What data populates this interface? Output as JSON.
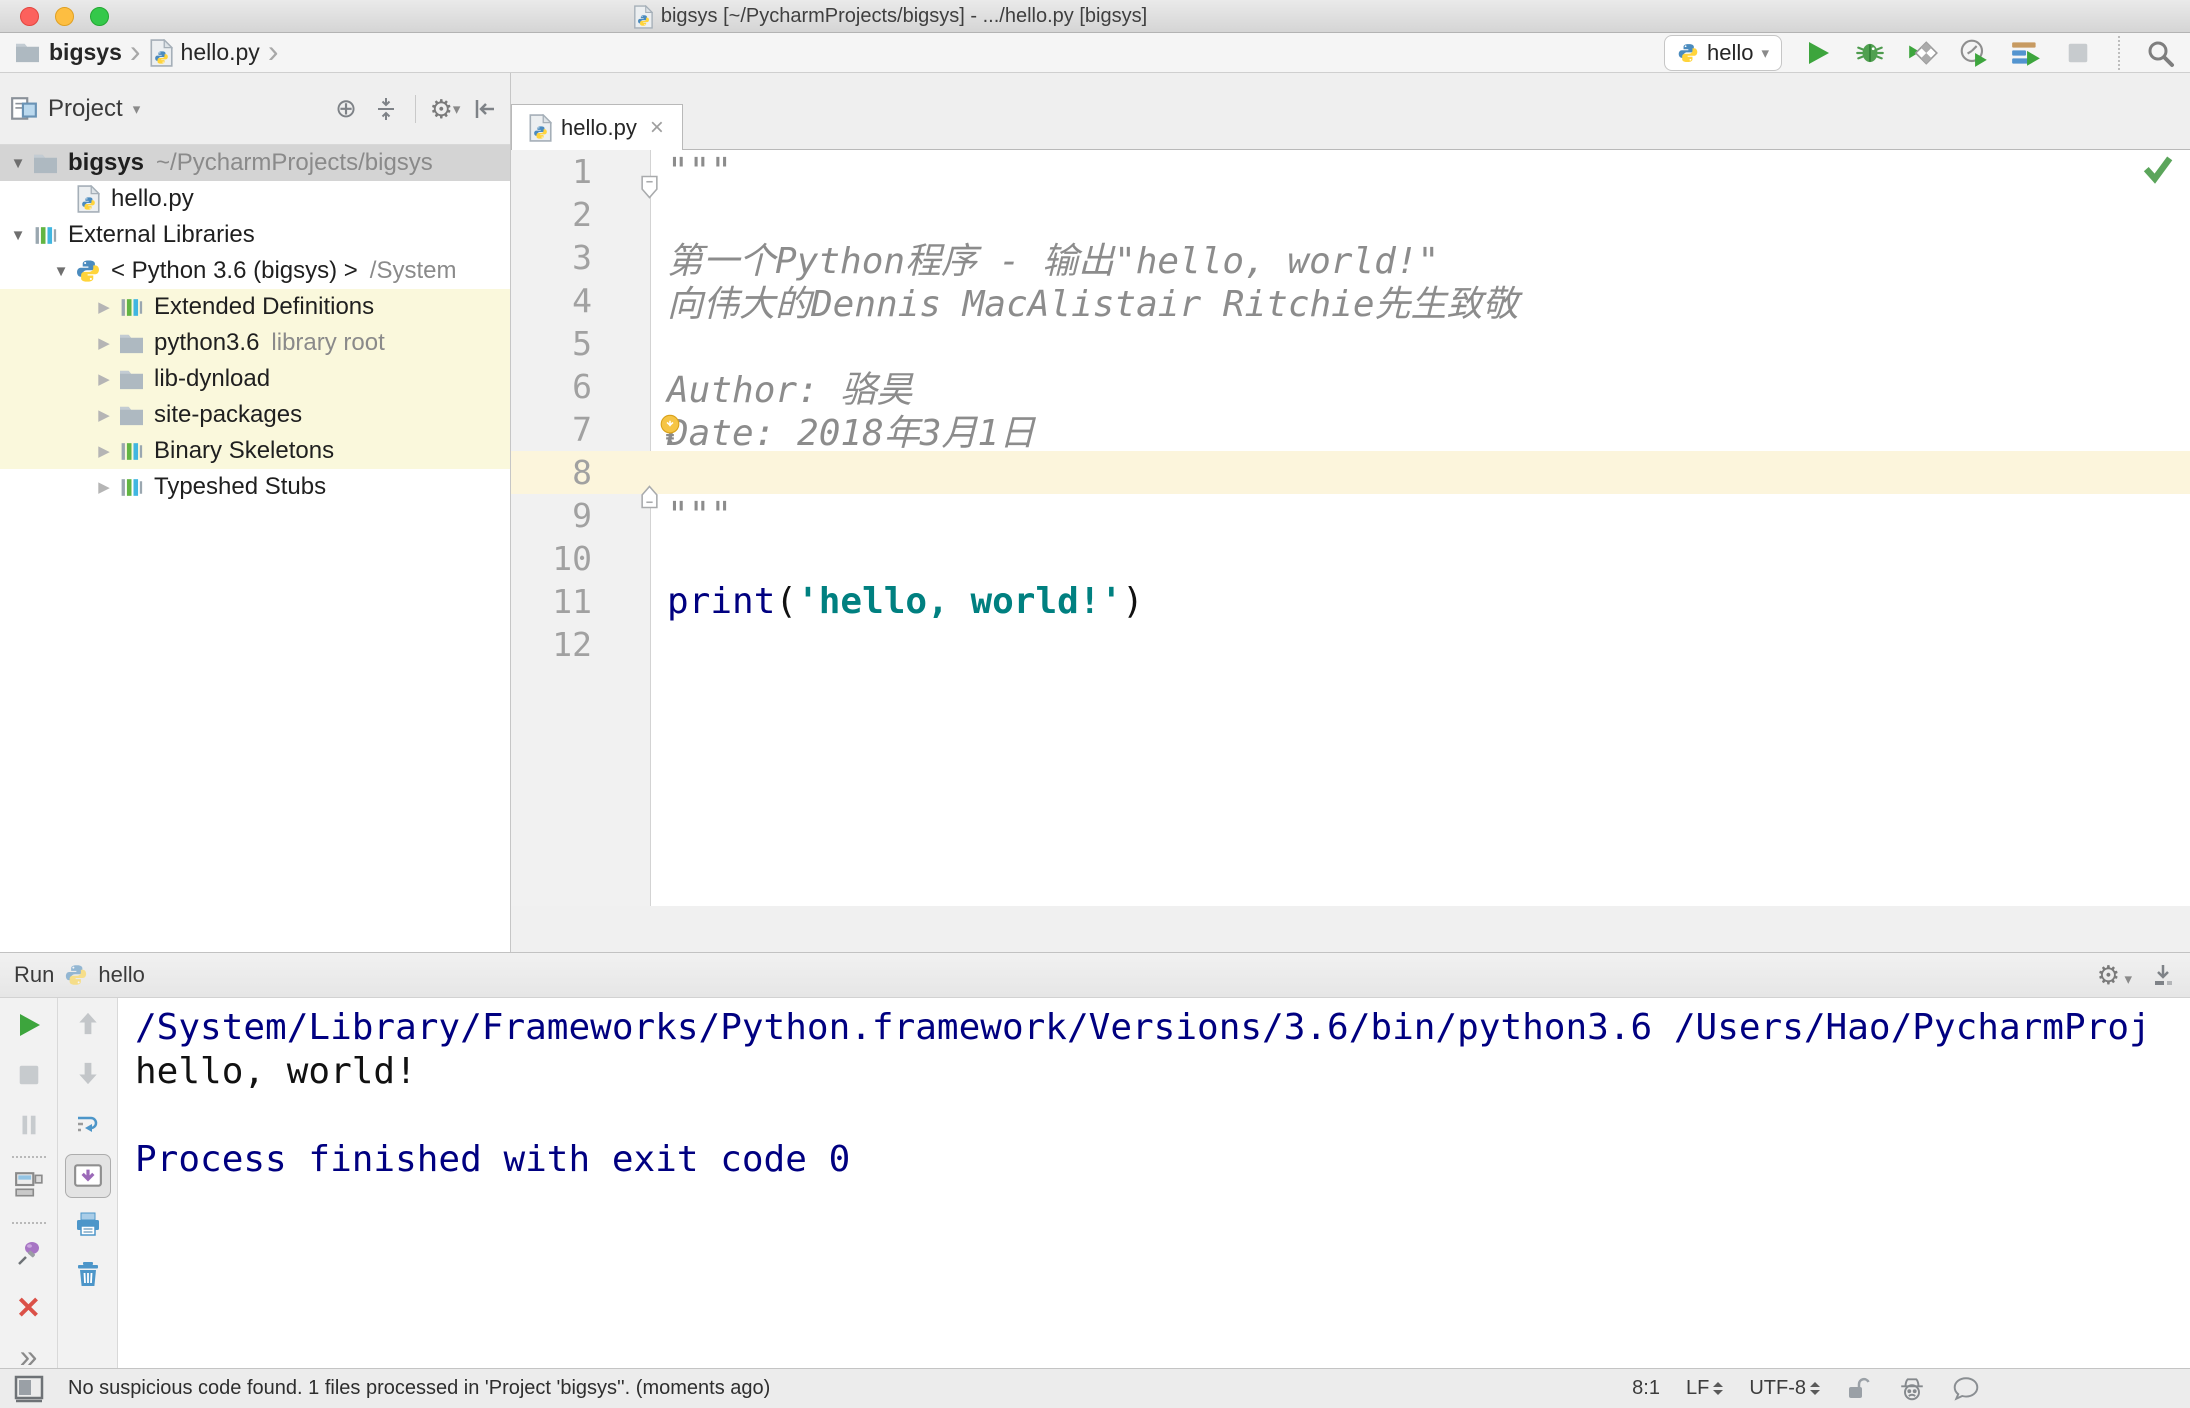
{
  "window": {
    "title": "bigsys [~/PycharmProjects/bigsys] - .../hello.py [bigsys]"
  },
  "icons": {
    "gear_glyph": "⚙",
    "caret_down": "▾",
    "breadcrumb_chevron": "›",
    "tab_close": "×",
    "close_x": "✕",
    "more_chevrons": "»",
    "locate_glyph": "⊕"
  },
  "navbar": {
    "crumb_project": "bigsys",
    "crumb_file": "hello.py",
    "run_config_label": "hello"
  },
  "project_panel": {
    "title": "Project",
    "tree": [
      {
        "label": "bigsys",
        "hint": "~/PycharmProjects/bigsys",
        "icon": "folder",
        "arrow": "expanded",
        "indent": 0,
        "selected": true,
        "bold": true
      },
      {
        "label": "hello.py",
        "icon": "pyfile",
        "arrow": "none",
        "indent": 1
      },
      {
        "label": "External Libraries",
        "icon": "lib",
        "arrow": "expanded",
        "indent": 0
      },
      {
        "label": "< Python 3.6 (bigsys) >",
        "hint": "/System",
        "icon": "python",
        "arrow": "expanded",
        "indent": 1
      },
      {
        "label": "Extended Definitions",
        "icon": "lib",
        "arrow": "collapsed",
        "indent": 2,
        "highlight": true
      },
      {
        "label": "python3.6",
        "hint": "library root",
        "icon": "folder",
        "arrow": "collapsed",
        "indent": 2,
        "highlight": true
      },
      {
        "label": "lib-dynload",
        "icon": "folder",
        "arrow": "collapsed",
        "indent": 2,
        "highlight": true
      },
      {
        "label": "site-packages",
        "icon": "folder",
        "arrow": "collapsed",
        "indent": 2,
        "highlight": true
      },
      {
        "label": "Binary Skeletons",
        "icon": "lib",
        "arrow": "collapsed",
        "indent": 2,
        "highlight": true
      },
      {
        "label": "Typeshed Stubs",
        "icon": "lib",
        "arrow": "collapsed",
        "indent": 2
      }
    ]
  },
  "editor": {
    "tab_label": "hello.py",
    "lines": [
      {
        "num": "1",
        "fold": "top",
        "parts": [
          {
            "t": "\"\"\"",
            "s": "doc"
          }
        ]
      },
      {
        "num": "2",
        "parts": []
      },
      {
        "num": "3",
        "parts": [
          {
            "t": "第一个Python程序 - 输出\"hello, world!\"",
            "s": "doc"
          }
        ]
      },
      {
        "num": "4",
        "parts": [
          {
            "t": "向伟大的Dennis MacAlistair Ritchie先生致敬",
            "s": "doc"
          }
        ]
      },
      {
        "num": "5",
        "parts": []
      },
      {
        "num": "6",
        "parts": [
          {
            "t": "Author: 骆昊",
            "s": "doc"
          }
        ]
      },
      {
        "num": "7",
        "bulb": true,
        "parts": [
          {
            "t": "Date: 2018年3月1日",
            "s": "doc"
          }
        ]
      },
      {
        "num": "8",
        "current": true,
        "parts": []
      },
      {
        "num": "9",
        "fold": "bottom",
        "parts": [
          {
            "t": "\"\"\"",
            "s": "doc"
          }
        ]
      },
      {
        "num": "10",
        "parts": []
      },
      {
        "num": "11",
        "parts": [
          {
            "t": "print",
            "s": "builtin"
          },
          {
            "t": "(",
            "s": "plain"
          },
          {
            "t": "'hello, world!'",
            "s": "str"
          },
          {
            "t": ")",
            "s": "plain"
          }
        ]
      },
      {
        "num": "12",
        "parts": []
      }
    ]
  },
  "run_panel": {
    "title": "Run",
    "config_label": "hello",
    "console": [
      {
        "text": "/System/Library/Frameworks/Python.framework/Versions/3.6/bin/python3.6 /Users/Hao/PycharmProj",
        "style": "sys"
      },
      {
        "text": "hello, world!",
        "style": "out"
      },
      {
        "text": "",
        "style": "out"
      },
      {
        "text": "Process finished with exit code 0",
        "style": "sys"
      }
    ]
  },
  "status_bar": {
    "message": "No suspicious code found. 1 files processed in 'Project 'bigsys''. (moments ago)",
    "caret_position": "8:1",
    "line_separator": "LF",
    "encoding": "UTF-8"
  },
  "colors": {
    "accent_green": "#3DA53D",
    "keyword_blue": "#000080",
    "string_teal": "#008080",
    "docstring_gray": "#8C8C8C",
    "console_system_blue": "#000080",
    "current_line_bg": "#FCF5DC",
    "library_highlight_bg": "#FAF8DC",
    "tree_selection_bg": "#D4D4D4"
  }
}
